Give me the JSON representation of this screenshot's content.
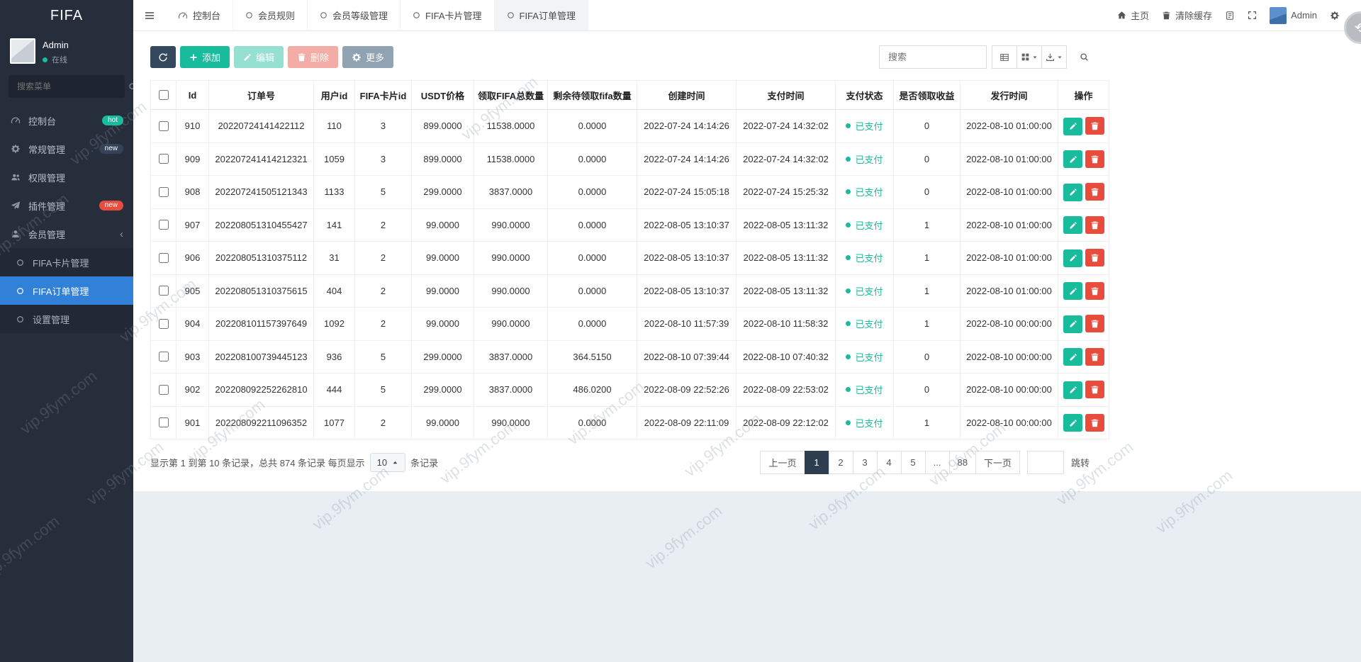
{
  "brand": "FIFA",
  "watermark_text": "vip.9fym.com",
  "sidebar": {
    "user_name": "Admin",
    "user_status": "在线",
    "search_placeholder": "搜索菜单",
    "items": [
      {
        "key": "dashboard",
        "label": "控制台",
        "icon": "gauge",
        "badge": "hot",
        "badge_color": "#18bc9c"
      },
      {
        "key": "general",
        "label": "常规管理",
        "icon": "cogs",
        "badge": "new",
        "badge_color": "#34425a"
      },
      {
        "key": "auth",
        "label": "权限管理",
        "icon": "users"
      },
      {
        "key": "addon",
        "label": "插件管理",
        "icon": "plane",
        "badge": "new",
        "badge_color": "#e74c3c"
      },
      {
        "key": "member",
        "label": "会员管理",
        "icon": "user",
        "expandable": true,
        "children": [
          {
            "key": "fifa-card",
            "label": "FIFA卡片管理"
          },
          {
            "key": "fifa-order",
            "label": "FIFA订单管理",
            "active": true
          },
          {
            "key": "settings",
            "label": "设置管理"
          }
        ]
      }
    ]
  },
  "topbar": {
    "tabs": [
      {
        "key": "dashboard",
        "label": "控制台",
        "icon": "gauge"
      },
      {
        "key": "member-rules",
        "label": "会员规则",
        "icon": "circle"
      },
      {
        "key": "member-level",
        "label": "会员等级管理",
        "icon": "circle"
      },
      {
        "key": "fifa-card",
        "label": "FIFA卡片管理",
        "icon": "circle"
      },
      {
        "key": "fifa-order",
        "label": "FIFA订单管理",
        "icon": "circle",
        "active": true
      }
    ],
    "home_label": "主页",
    "clear_cache_label": "清除缓存",
    "user_label": "Admin"
  },
  "toolbar": {
    "add_label": "添加",
    "edit_label": "编辑",
    "delete_label": "删除",
    "more_label": "更多",
    "search_placeholder": "搜索"
  },
  "table": {
    "columns": [
      "Id",
      "订单号",
      "用户id",
      "FIFA卡片id",
      "USDT价格",
      "领取FIFA总数量",
      "剩余待领取fifa数量",
      "创建时间",
      "支付时间",
      "支付状态",
      "是否领取收益",
      "发行时间",
      "操作"
    ],
    "pay_status": "已支付",
    "rows": [
      {
        "id": "910",
        "order_no": "20220724141422112",
        "user_id": "110",
        "card_id": "3",
        "price": "899.0000",
        "total": "11538.0000",
        "remaining": "0.0000",
        "created": "2022-07-24 14:14:26",
        "paid": "2022-07-24 14:32:02",
        "income": "0",
        "issued": "2022-08-10 01:00:00"
      },
      {
        "id": "909",
        "order_no": "202207241414212321",
        "user_id": "1059",
        "card_id": "3",
        "price": "899.0000",
        "total": "11538.0000",
        "remaining": "0.0000",
        "created": "2022-07-24 14:14:26",
        "paid": "2022-07-24 14:32:02",
        "income": "0",
        "issued": "2022-08-10 01:00:00"
      },
      {
        "id": "908",
        "order_no": "202207241505121343",
        "user_id": "1133",
        "card_id": "5",
        "price": "299.0000",
        "total": "3837.0000",
        "remaining": "0.0000",
        "created": "2022-07-24 15:05:18",
        "paid": "2022-07-24 15:25:32",
        "income": "0",
        "issued": "2022-08-10 01:00:00"
      },
      {
        "id": "907",
        "order_no": "202208051310455427",
        "user_id": "141",
        "card_id": "2",
        "price": "99.0000",
        "total": "990.0000",
        "remaining": "0.0000",
        "created": "2022-08-05 13:10:37",
        "paid": "2022-08-05 13:11:32",
        "income": "1",
        "issued": "2022-08-10 01:00:00"
      },
      {
        "id": "906",
        "order_no": "202208051310375112",
        "user_id": "31",
        "card_id": "2",
        "price": "99.0000",
        "total": "990.0000",
        "remaining": "0.0000",
        "created": "2022-08-05 13:10:37",
        "paid": "2022-08-05 13:11:32",
        "income": "1",
        "issued": "2022-08-10 01:00:00"
      },
      {
        "id": "905",
        "order_no": "202208051310375615",
        "user_id": "404",
        "card_id": "2",
        "price": "99.0000",
        "total": "990.0000",
        "remaining": "0.0000",
        "created": "2022-08-05 13:10:37",
        "paid": "2022-08-05 13:11:32",
        "income": "1",
        "issued": "2022-08-10 01:00:00"
      },
      {
        "id": "904",
        "order_no": "202208101157397649",
        "user_id": "1092",
        "card_id": "2",
        "price": "99.0000",
        "total": "990.0000",
        "remaining": "0.0000",
        "created": "2022-08-10 11:57:39",
        "paid": "2022-08-10 11:58:32",
        "income": "1",
        "issued": "2022-08-10 00:00:00"
      },
      {
        "id": "903",
        "order_no": "202208100739445123",
        "user_id": "936",
        "card_id": "5",
        "price": "299.0000",
        "total": "3837.0000",
        "remaining": "364.5150",
        "created": "2022-08-10 07:39:44",
        "paid": "2022-08-10 07:40:32",
        "income": "0",
        "issued": "2022-08-10 00:00:00"
      },
      {
        "id": "902",
        "order_no": "202208092252262810",
        "user_id": "444",
        "card_id": "5",
        "price": "299.0000",
        "total": "3837.0000",
        "remaining": "486.0200",
        "created": "2022-08-09 22:52:26",
        "paid": "2022-08-09 22:53:02",
        "income": "0",
        "issued": "2022-08-10 00:00:00"
      },
      {
        "id": "901",
        "order_no": "202208092211096352",
        "user_id": "1077",
        "card_id": "2",
        "price": "99.0000",
        "total": "990.0000",
        "remaining": "0.0000",
        "created": "2022-08-09 22:11:09",
        "paid": "2022-08-09 22:12:02",
        "income": "1",
        "issued": "2022-08-10 00:00:00"
      }
    ]
  },
  "footer": {
    "summary_prefix": "显示第 1 到第 10 条记录，总共 874 条记录 每页显示",
    "page_size": "10",
    "summary_suffix": "条记录",
    "pages": [
      "上一页",
      "1",
      "2",
      "3",
      "4",
      "5",
      "...",
      "88",
      "下一页"
    ],
    "active_page": "1",
    "jump_label": "跳转"
  }
}
